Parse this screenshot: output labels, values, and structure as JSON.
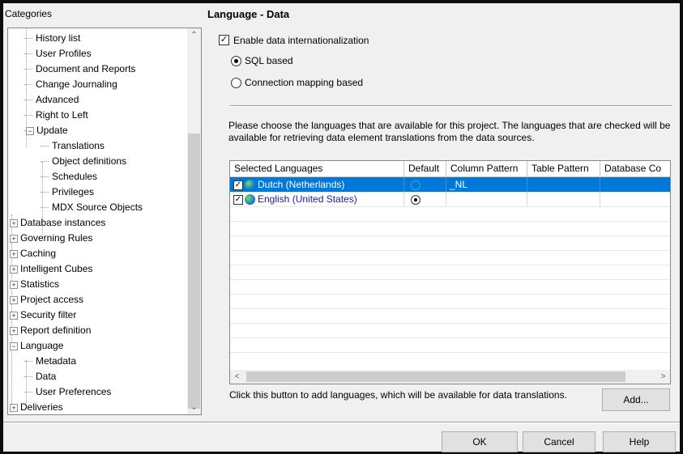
{
  "left_panel": {
    "title": "Categories",
    "tree": [
      {
        "label": "History list",
        "level": 2,
        "expander": ""
      },
      {
        "label": "User Profiles",
        "level": 2,
        "expander": ""
      },
      {
        "label": "Document and Reports",
        "level": 2,
        "expander": ""
      },
      {
        "label": "Change Journaling",
        "level": 2,
        "expander": ""
      },
      {
        "label": "Advanced",
        "level": 2,
        "expander": ""
      },
      {
        "label": "Right to Left",
        "level": 2,
        "expander": ""
      },
      {
        "label": "Update",
        "level": 2,
        "expander": "-"
      },
      {
        "label": "Translations",
        "level": 3,
        "expander": ""
      },
      {
        "label": "Object definitions",
        "level": 3,
        "expander": ""
      },
      {
        "label": "Schedules",
        "level": 3,
        "expander": ""
      },
      {
        "label": "Privileges",
        "level": 3,
        "expander": ""
      },
      {
        "label": "MDX Source Objects",
        "level": 3,
        "expander": ""
      },
      {
        "label": "Database instances",
        "level": 1,
        "expander": "+"
      },
      {
        "label": "Governing Rules",
        "level": 1,
        "expander": "+"
      },
      {
        "label": "Caching",
        "level": 1,
        "expander": "+"
      },
      {
        "label": "Intelligent Cubes",
        "level": 1,
        "expander": "+"
      },
      {
        "label": "Statistics",
        "level": 1,
        "expander": "+"
      },
      {
        "label": "Project access",
        "level": 1,
        "expander": "+"
      },
      {
        "label": "Security filter",
        "level": 1,
        "expander": "+"
      },
      {
        "label": "Report definition",
        "level": 1,
        "expander": "+"
      },
      {
        "label": "Language",
        "level": 1,
        "expander": "-"
      },
      {
        "label": "Metadata",
        "level": 2,
        "expander": ""
      },
      {
        "label": "Data",
        "level": 2,
        "expander": ""
      },
      {
        "label": "User Preferences",
        "level": 2,
        "expander": ""
      },
      {
        "label": "Deliveries",
        "level": 1,
        "expander": "+"
      }
    ]
  },
  "right_panel": {
    "title": "Language - Data",
    "enable_checkbox": {
      "label": "Enable data internationalization",
      "checked": true
    },
    "radio_sql": {
      "label": "SQL based",
      "selected": true
    },
    "radio_conn": {
      "label": "Connection mapping based",
      "selected": false
    },
    "description": "Please choose the languages that are available for this project. The languages that are checked will be available for retrieving data element translations from the data sources.",
    "grid": {
      "columns": [
        "Selected Languages",
        "Default",
        "Column Pattern",
        "Table Pattern",
        "Database Co"
      ],
      "rows": [
        {
          "language": "Dutch (Netherlands)",
          "checked": true,
          "default": false,
          "column_pattern": "_NL",
          "table_pattern": "",
          "database_connection": "",
          "selected": true
        },
        {
          "language": "English (United States)",
          "checked": true,
          "default": true,
          "column_pattern": "",
          "table_pattern": "",
          "database_connection": "",
          "selected": false
        }
      ]
    },
    "add_hint": "Click this button to add languages, which will be available for data translations.",
    "add_button": "Add..."
  },
  "footer": {
    "ok": "OK",
    "cancel": "Cancel",
    "help": "Help"
  },
  "colors": {
    "selection": "#0078d7",
    "link_text": "#1a1aa6"
  }
}
